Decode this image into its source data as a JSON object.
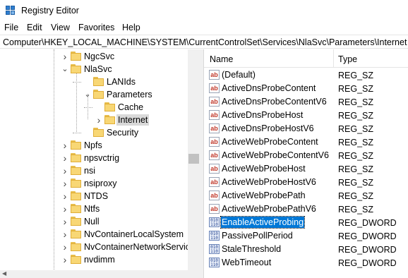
{
  "window": {
    "title": "Registry Editor"
  },
  "menu": [
    "File",
    "Edit",
    "View",
    "Favorites",
    "Help"
  ],
  "address": "Computer\\HKEY_LOCAL_MACHINE\\SYSTEM\\CurrentControlSet\\Services\\NlaSvc\\Parameters\\Internet",
  "tree": [
    {
      "label": "NgcSvc",
      "depth": 0,
      "expander": "right",
      "selected": false
    },
    {
      "label": "NlaSvc",
      "depth": 0,
      "expander": "down",
      "selected": false
    },
    {
      "label": "LANIds",
      "depth": 1,
      "expander": "none",
      "selected": false
    },
    {
      "label": "Parameters",
      "depth": 1,
      "expander": "down",
      "selected": false
    },
    {
      "label": "Cache",
      "depth": 2,
      "expander": "none",
      "selected": false
    },
    {
      "label": "Internet",
      "depth": 2,
      "expander": "right",
      "selected": true
    },
    {
      "label": "Security",
      "depth": 1,
      "expander": "none",
      "selected": false
    },
    {
      "label": "Npfs",
      "depth": 0,
      "expander": "right",
      "selected": false
    },
    {
      "label": "npsvctrig",
      "depth": 0,
      "expander": "right",
      "selected": false
    },
    {
      "label": "nsi",
      "depth": 0,
      "expander": "right",
      "selected": false
    },
    {
      "label": "nsiproxy",
      "depth": 0,
      "expander": "right",
      "selected": false
    },
    {
      "label": "NTDS",
      "depth": 0,
      "expander": "right",
      "selected": false
    },
    {
      "label": "Ntfs",
      "depth": 0,
      "expander": "right",
      "selected": false
    },
    {
      "label": "Null",
      "depth": 0,
      "expander": "right",
      "selected": false
    },
    {
      "label": "NvContainerLocalSystem",
      "depth": 0,
      "expander": "right",
      "selected": false
    },
    {
      "label": "NvContainerNetworkService",
      "depth": 0,
      "expander": "right",
      "selected": false
    },
    {
      "label": "nvdimm",
      "depth": 0,
      "expander": "right",
      "selected": false
    }
  ],
  "list": {
    "columns": {
      "name": "Name",
      "type": "Type"
    },
    "rows": [
      {
        "name": "(Default)",
        "type": "REG_SZ",
        "icon": "string-value-icon",
        "selected": false
      },
      {
        "name": "ActiveDnsProbeContent",
        "type": "REG_SZ",
        "icon": "string-value-icon",
        "selected": false
      },
      {
        "name": "ActiveDnsProbeContentV6",
        "type": "REG_SZ",
        "icon": "string-value-icon",
        "selected": false
      },
      {
        "name": "ActiveDnsProbeHost",
        "type": "REG_SZ",
        "icon": "string-value-icon",
        "selected": false
      },
      {
        "name": "ActiveDnsProbeHostV6",
        "type": "REG_SZ",
        "icon": "string-value-icon",
        "selected": false
      },
      {
        "name": "ActiveWebProbeContent",
        "type": "REG_SZ",
        "icon": "string-value-icon",
        "selected": false
      },
      {
        "name": "ActiveWebProbeContentV6",
        "type": "REG_SZ",
        "icon": "string-value-icon",
        "selected": false
      },
      {
        "name": "ActiveWebProbeHost",
        "type": "REG_SZ",
        "icon": "string-value-icon",
        "selected": false
      },
      {
        "name": "ActiveWebProbeHostV6",
        "type": "REG_SZ",
        "icon": "string-value-icon",
        "selected": false
      },
      {
        "name": "ActiveWebProbePath",
        "type": "REG_SZ",
        "icon": "string-value-icon",
        "selected": false
      },
      {
        "name": "ActiveWebProbePathV6",
        "type": "REG_SZ",
        "icon": "string-value-icon",
        "selected": false
      },
      {
        "name": "EnableActiveProbing",
        "type": "REG_DWORD",
        "icon": "binary-value-icon",
        "selected": true
      },
      {
        "name": "PassivePollPeriod",
        "type": "REG_DWORD",
        "icon": "binary-value-icon",
        "selected": false
      },
      {
        "name": "StaleThreshold",
        "type": "REG_DWORD",
        "icon": "binary-value-icon",
        "selected": false
      },
      {
        "name": "WebTimeout",
        "type": "REG_DWORD",
        "icon": "binary-value-icon",
        "selected": false
      }
    ]
  },
  "colors": {
    "selection": "#0078d7",
    "folder": "#f8d775",
    "tree_selection": "#d9d9d9"
  }
}
